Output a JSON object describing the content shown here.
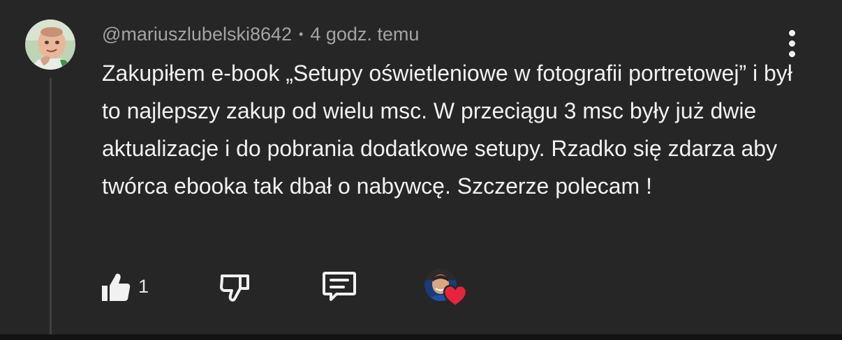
{
  "comment": {
    "author": "@mariuszlubelski8642",
    "separator": "•",
    "timestamp": "4 godz. temu",
    "text": "Zakupiłem e-book „Setupy oświetleniowe w fotografii portretowej” i był to najlepszy zakup od wielu msc. W przeciągu 3 msc były już dwie aktualizacje i do pobrania dodatkowe setupy. Rzadko się zdarza aby twórca ebooka tak dbał o nabywcę. Szczerze polecam !",
    "like_count": "1"
  },
  "icons": {
    "like": "thumbs-up-icon",
    "dislike": "thumbs-down-icon",
    "reply": "comment-icon",
    "creator_heart": "heart-icon",
    "menu": "more-vertical-icon"
  },
  "colors": {
    "background": "#262626",
    "text_primary": "#f1f1f1",
    "text_secondary": "#a4a4a4",
    "heart": "#e8243c",
    "thread_line": "#3f3f3f"
  }
}
